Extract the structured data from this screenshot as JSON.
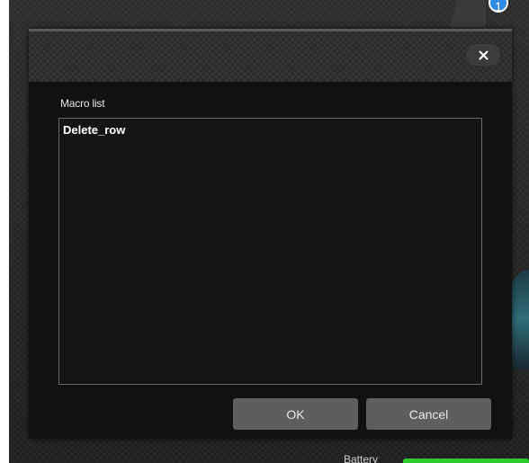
{
  "background": {
    "notification_badge": "1",
    "battery_label": "Battery",
    "battery_color": "#2ecc2e",
    "badge_color": "#2f8ae6"
  },
  "dialog": {
    "close_icon": "close-icon",
    "label": "Macro list",
    "macros": [
      {
        "name": "Delete_row"
      }
    ],
    "ok_label": "OK",
    "cancel_label": "Cancel",
    "button_color": "#5e5e5e"
  }
}
